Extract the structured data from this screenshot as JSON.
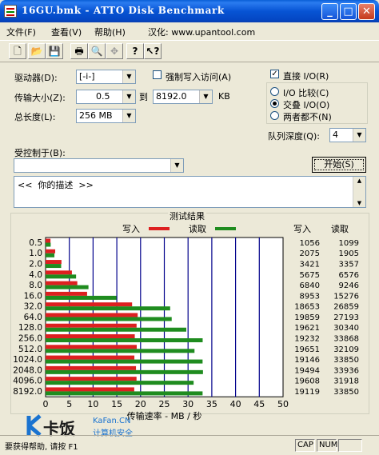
{
  "window": {
    "title": "16GU.bmk - ATTO Disk Benchmark"
  },
  "menu": {
    "file": "文件(F)",
    "view": "查看(V)",
    "help": "帮助(H)",
    "localized": "汉化: www.upantool.com"
  },
  "toolbar_icons": [
    "new-file-icon",
    "open-folder-icon",
    "save-icon",
    "print-icon",
    "print-preview-icon",
    "move-icon",
    "help-icon",
    "context-help-icon"
  ],
  "form": {
    "drive_label": "驱动器(D):",
    "drive_value": "[-i-]",
    "force_write_label": "强制写入访问(A)",
    "force_write_checked": false,
    "transfer_size_label": "传输大小(Z):",
    "transfer_from": "0.5",
    "to_label": "到",
    "transfer_to": "8192.0",
    "kb_label": "KB",
    "total_length_label": "总长度(L):",
    "total_length_value": "256 MB",
    "direct_io_label": "直接 I/O(R)",
    "direct_io_checked": true,
    "io_compare_label": "I/O 比较(C)",
    "overlap_io_label": "交叠 I/O(O)",
    "neither_label": "两者都不(N)",
    "queue_depth_label": "队列深度(Q):",
    "queue_depth_value": "4",
    "controlled_by_label": "受控制于(B):",
    "controlled_by_value": "",
    "start_button": "开始(S)",
    "description": "<<  你的描述  >>"
  },
  "results": {
    "title": "测试结果",
    "write_label": "写入",
    "read_label": "读取",
    "col_write": "写入",
    "col_read": "读取",
    "xaxis_label": "传输速率 - MB / 秒"
  },
  "colors": {
    "write": "#dd2020",
    "read": "#1f8c1f",
    "grid_line": "#00008b"
  },
  "chart_data": {
    "type": "bar",
    "orientation": "horizontal",
    "categories": [
      "0.5",
      "1.0",
      "2.0",
      "4.0",
      "8.0",
      "16.0",
      "32.0",
      "64.0",
      "128.0",
      "256.0",
      "512.0",
      "1024.0",
      "2048.0",
      "4096.0",
      "8192.0"
    ],
    "series": [
      {
        "name": "写入",
        "values": [
          1056,
          2075,
          3421,
          5675,
          6840,
          8953,
          18653,
          19859,
          19621,
          19232,
          19651,
          19146,
          19494,
          19608,
          19119
        ]
      },
      {
        "name": "读取",
        "values": [
          1099,
          1905,
          3357,
          6576,
          9246,
          15276,
          26859,
          27193,
          30340,
          33868,
          32109,
          33850,
          33936,
          31918,
          33850
        ]
      }
    ],
    "xlim": [
      0,
      50
    ],
    "xticks": [
      "0",
      "5",
      "10",
      "15",
      "20",
      "25",
      "30",
      "35",
      "40",
      "45",
      "50"
    ],
    "xlabel": "传输速率 - MB / 秒",
    "units_note": "values in KB/s, axis in MB/s"
  },
  "statusbar": {
    "text": "要获得帮助, 请按 F1",
    "cap": "CAP",
    "num": "NUM"
  },
  "watermark": {
    "brand": "卡饭",
    "site": "KaFan.CN",
    "tagline": "计算机安全"
  }
}
